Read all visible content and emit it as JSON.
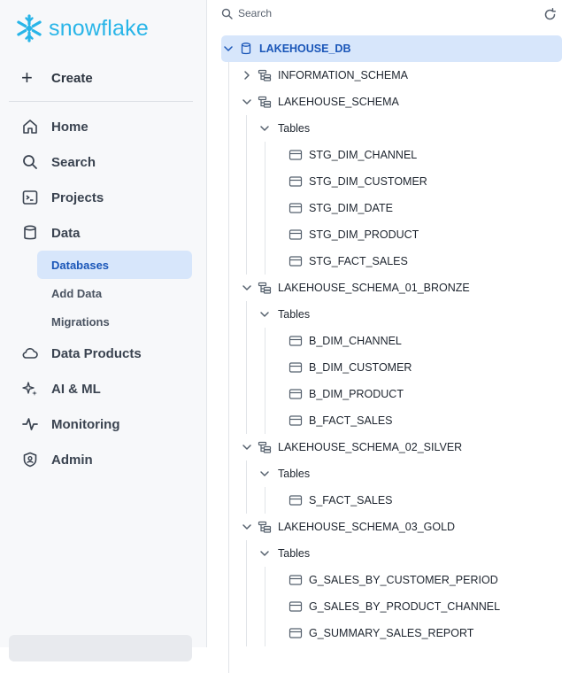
{
  "brand": {
    "name": "snowflake",
    "color": "#29b5e8"
  },
  "nav": {
    "create": "Create",
    "home": "Home",
    "search": "Search",
    "projects": "Projects",
    "data": "Data",
    "databases": "Databases",
    "add_data": "Add Data",
    "migrations": "Migrations",
    "data_products": "Data Products",
    "ai_ml": "AI & ML",
    "monitoring": "Monitoring",
    "admin": "Admin"
  },
  "tree": {
    "search_placeholder": "Search",
    "database": "LAKEHOUSE_DB",
    "schemas": [
      {
        "name": "INFORMATION_SCHEMA",
        "expanded": false
      },
      {
        "name": "LAKEHOUSE_SCHEMA",
        "expanded": true,
        "folder": "Tables",
        "tables": [
          "STG_DIM_CHANNEL",
          "STG_DIM_CUSTOMER",
          "STG_DIM_DATE",
          "STG_DIM_PRODUCT",
          "STG_FACT_SALES"
        ]
      },
      {
        "name": "LAKEHOUSE_SCHEMA_01_BRONZE",
        "expanded": true,
        "folder": "Tables",
        "tables": [
          "B_DIM_CHANNEL",
          "B_DIM_CUSTOMER",
          "B_DIM_PRODUCT",
          "B_FACT_SALES"
        ]
      },
      {
        "name": "LAKEHOUSE_SCHEMA_02_SILVER",
        "expanded": true,
        "folder": "Tables",
        "tables": [
          "S_FACT_SALES"
        ]
      },
      {
        "name": "LAKEHOUSE_SCHEMA_03_GOLD",
        "expanded": true,
        "folder": "Tables",
        "tables": [
          "G_SALES_BY_CUSTOMER_PERIOD",
          "G_SALES_BY_PRODUCT_CHANNEL",
          "G_SUMMARY_SALES_REPORT"
        ]
      }
    ]
  }
}
